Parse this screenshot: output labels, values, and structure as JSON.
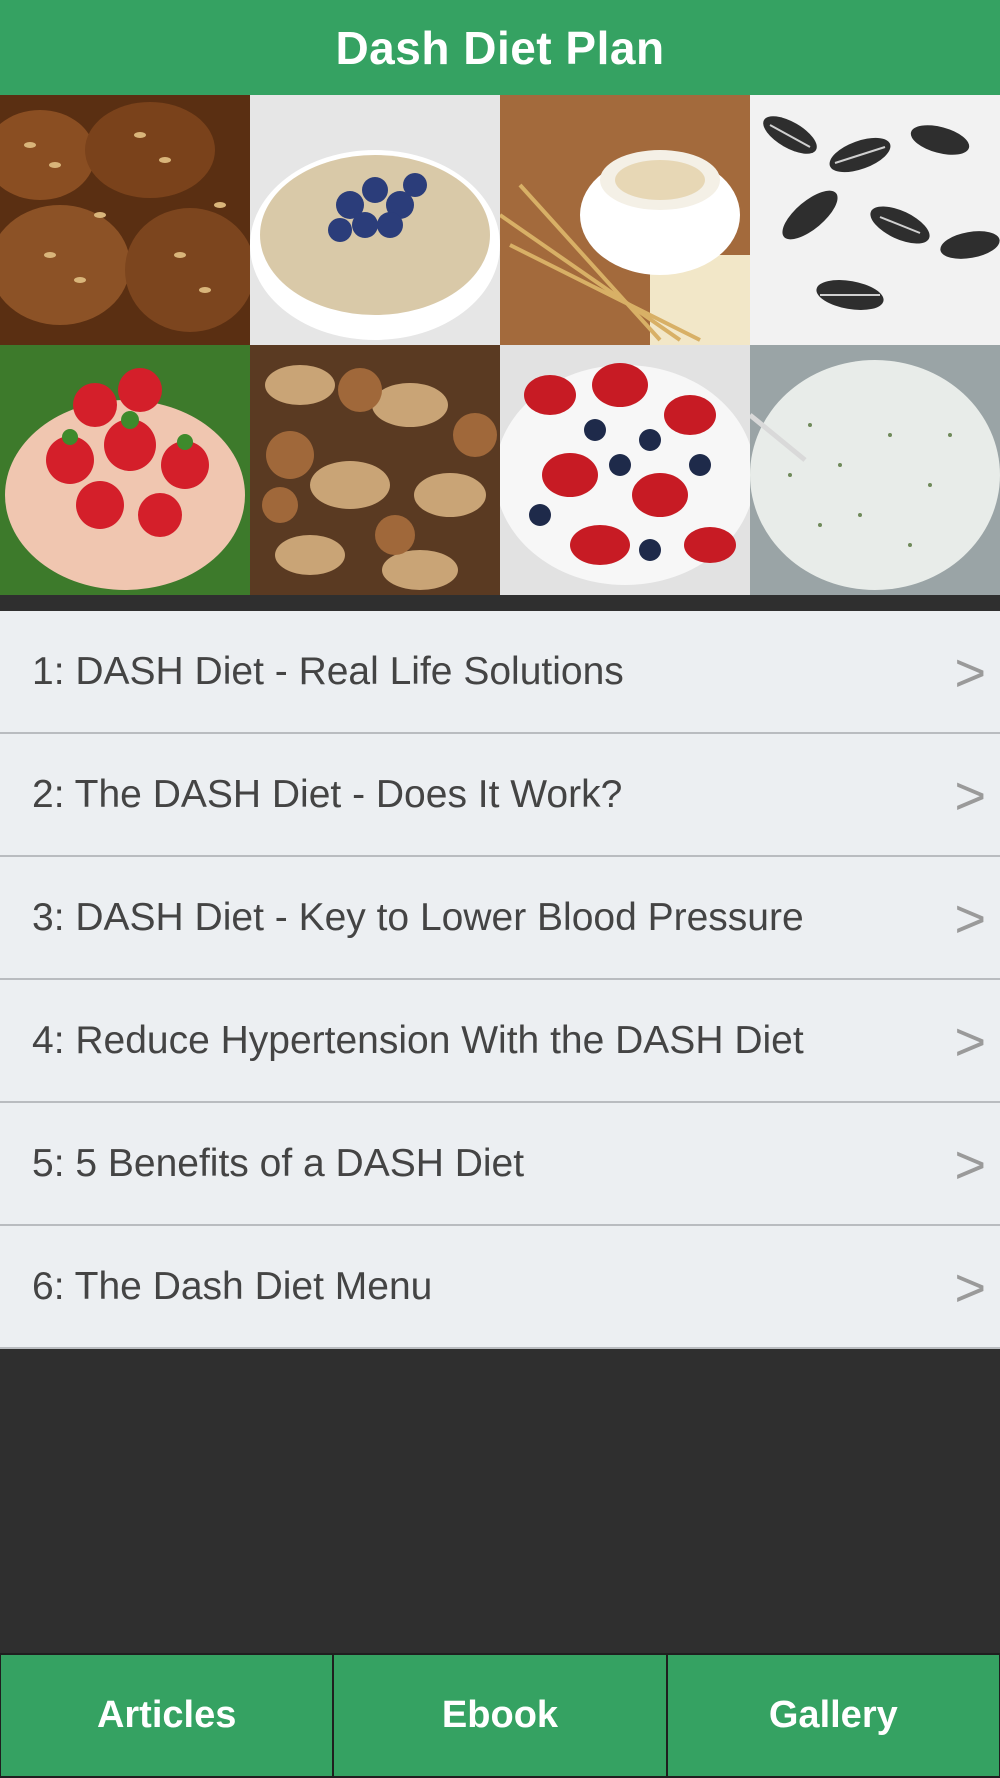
{
  "header": {
    "title": "Dash Diet Plan"
  },
  "gallery": {
    "tiles": [
      {
        "name": "seeded-bread-photo"
      },
      {
        "name": "oatmeal-blueberries-photo"
      },
      {
        "name": "muesli-cup-wheat-photo"
      },
      {
        "name": "sunflower-seeds-photo"
      },
      {
        "name": "strawberries-hands-photo"
      },
      {
        "name": "mixed-nuts-photo"
      },
      {
        "name": "strawberries-blueberries-photo"
      },
      {
        "name": "yogurt-herb-dip-photo"
      }
    ]
  },
  "list": {
    "items": [
      {
        "label": "1: DASH Diet - Real Life Solutions",
        "chevron": ">"
      },
      {
        "label": "2: The DASH Diet - Does It Work?",
        "chevron": ">"
      },
      {
        "label": "3: DASH Diet - Key to Lower Blood Pressure",
        "chevron": ">"
      },
      {
        "label": "4: Reduce Hypertension With the DASH Diet",
        "chevron": ">"
      },
      {
        "label": "5: 5 Benefits of a DASH Diet",
        "chevron": ">"
      },
      {
        "label": "6: The Dash Diet Menu",
        "chevron": ">"
      }
    ]
  },
  "tabs": [
    {
      "label": "Articles"
    },
    {
      "label": "Ebook"
    },
    {
      "label": "Gallery"
    }
  ],
  "colors": {
    "accent": "#35a262",
    "background": "#2f2f2f",
    "row": "#eceff2"
  }
}
